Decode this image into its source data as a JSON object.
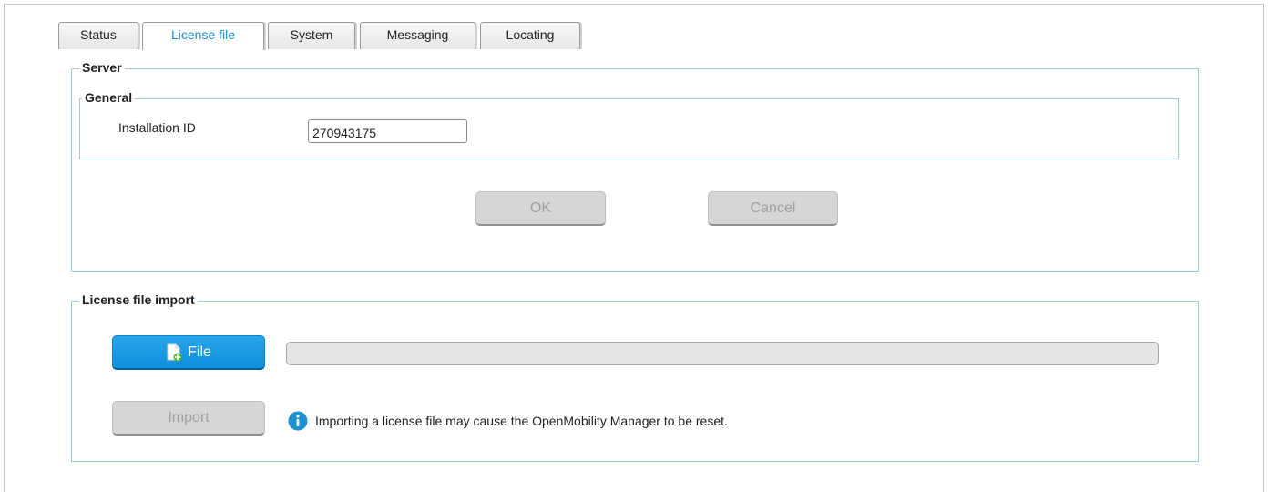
{
  "tabs": [
    {
      "label": "Status",
      "active": false
    },
    {
      "label": "License file",
      "active": true
    },
    {
      "label": "System",
      "active": false
    },
    {
      "label": "Messaging",
      "active": false
    },
    {
      "label": "Locating",
      "active": false
    }
  ],
  "server": {
    "legend": "Server",
    "general": {
      "legend": "General",
      "installation_id_label": "Installation ID",
      "installation_id_value": "270943175"
    },
    "ok_label": "OK",
    "cancel_label": "Cancel"
  },
  "license_import": {
    "legend": "License file import",
    "file_button_label": "File",
    "import_button_label": "Import",
    "progress_fraction": 0,
    "info_text": "Importing a license file may cause the OpenMobility Manager to be reset."
  },
  "colors": {
    "accent": "#1e90d0",
    "group_border": "#9ccbe6",
    "disabled_button": "#d6d6d6"
  },
  "icons": {
    "file_button_icon": "file-add-icon",
    "info_icon": "info-icon"
  }
}
